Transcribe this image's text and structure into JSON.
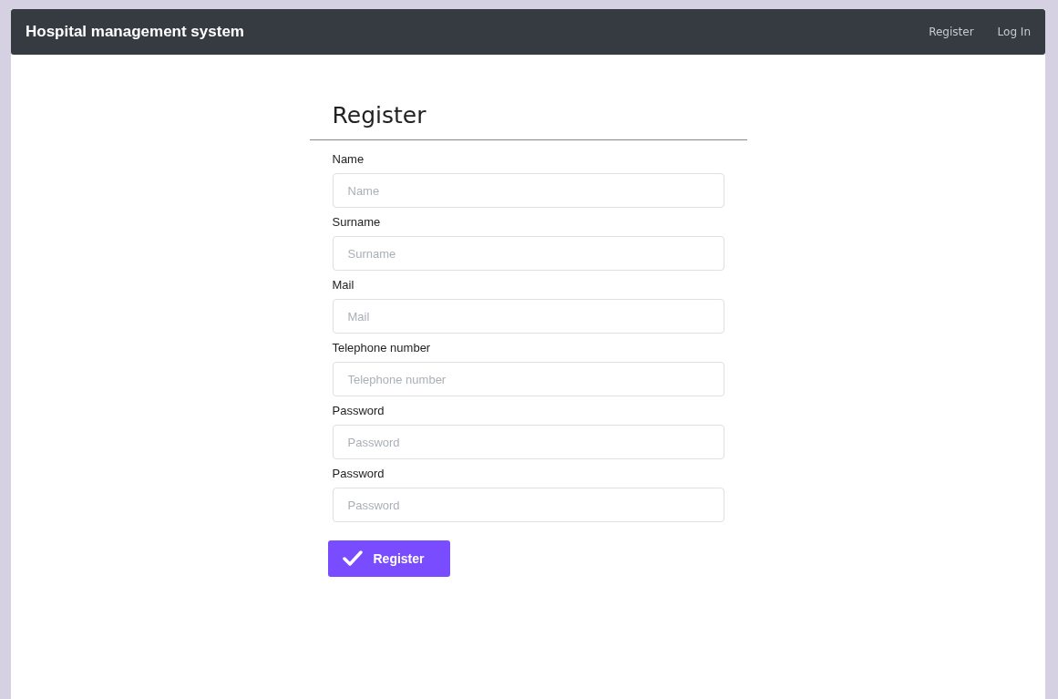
{
  "navbar": {
    "brand": "Hospital management system",
    "links": [
      "Register",
      "Log In"
    ]
  },
  "form": {
    "title": "Register",
    "fields": [
      {
        "label": "Name",
        "placeholder": "Name"
      },
      {
        "label": "Surname",
        "placeholder": "Surname"
      },
      {
        "label": "Mail",
        "placeholder": "Mail"
      },
      {
        "label": "Telephone number",
        "placeholder": "Telephone number"
      },
      {
        "label": "Password",
        "placeholder": "Password"
      },
      {
        "label": "Password",
        "placeholder": "Password"
      }
    ],
    "submit": "Register"
  }
}
